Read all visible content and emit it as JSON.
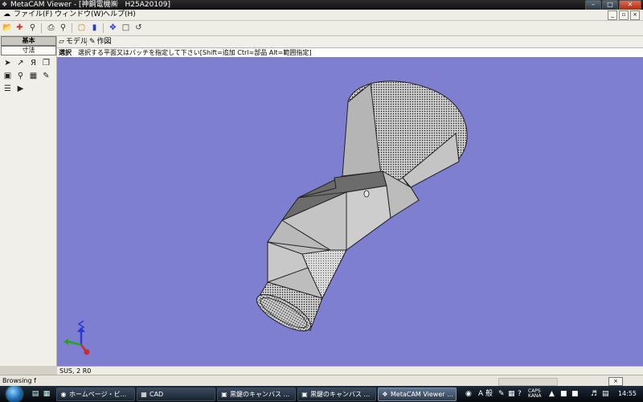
{
  "window": {
    "title": "MetaCAM Viewer - [神鋼電機㈱　H25A20109]"
  },
  "menu": {
    "items": [
      "ファイル(F)",
      "ウィンドウ(W)",
      "ヘルプ(H)"
    ]
  },
  "left_panel": {
    "tabs": [
      "基本",
      "寸法"
    ]
  },
  "view_tabs": [
    "モデル",
    "作図"
  ],
  "prompt": {
    "mode": "選択",
    "text": "選択する平面又はパッチを指定して下さい[Shift=追加 Ctrl=部品 Alt=範囲指定]"
  },
  "status": {
    "text": "SUS, 2 R0"
  },
  "browse": {
    "text": "Browsing f"
  },
  "taskbar": {
    "buttons": [
      "ホームページ・ビ...",
      "CAD",
      "黒鍵のキャンバス ...",
      "黒鍵のキャンバス ...",
      "MetaCAM Viewer ..."
    ],
    "active_index": 4,
    "tray_ime": "A 般",
    "tray_caps": "CAPS KANA",
    "clock": "14:55"
  },
  "colors": {
    "viewport_bg": "#7f7fd1",
    "model_face": "#c9c9c9",
    "model_dark_face": "#6a6a6a",
    "axis_x": "#2aa02a",
    "axis_y": "#2a3ad0",
    "axis_z": "#d02a2a"
  },
  "icons": {
    "toolbar": [
      "open-folder-icon",
      "open-file-icon",
      "find-icon",
      "print-icon",
      "print-preview-icon",
      "properties-icon",
      "document-icon",
      "pan-icon",
      "zoom-window-icon",
      "rotate-icon"
    ],
    "tools": [
      "select-arrow-icon",
      "query-icon",
      "person-icon",
      "layer-icon",
      "display-icon",
      "zoom-icon",
      "grid-icon",
      "notes-icon",
      "stack-icon",
      "play-icon"
    ]
  }
}
